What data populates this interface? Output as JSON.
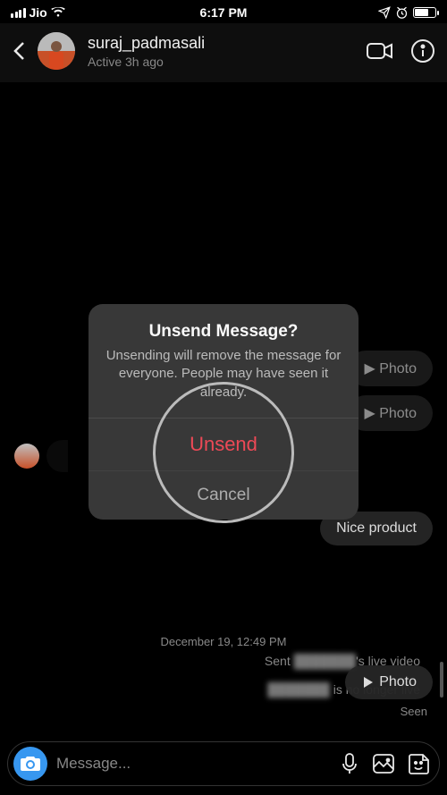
{
  "status_bar": {
    "carrier": "Jio",
    "time": "6:17 PM"
  },
  "header": {
    "username": "suraj_padmasali",
    "activity": "Active 3h ago"
  },
  "chat": {
    "photo_label_1": "Photo",
    "photo_label_2": "Photo",
    "nice_product": "Nice product",
    "sent_prefix": "Sent ",
    "sent_middle": "'s live video",
    "sent_line2": " is no longer live",
    "timestamp": "December 19, 12:49 PM",
    "bottom_photo": "Photo",
    "seen": "Seen"
  },
  "input": {
    "placeholder": "Message..."
  },
  "dialog": {
    "title": "Unsend Message?",
    "body": "Unsending will remove the message for everyone. People may have seen it already.",
    "action": "Unsend",
    "cancel": "Cancel"
  }
}
